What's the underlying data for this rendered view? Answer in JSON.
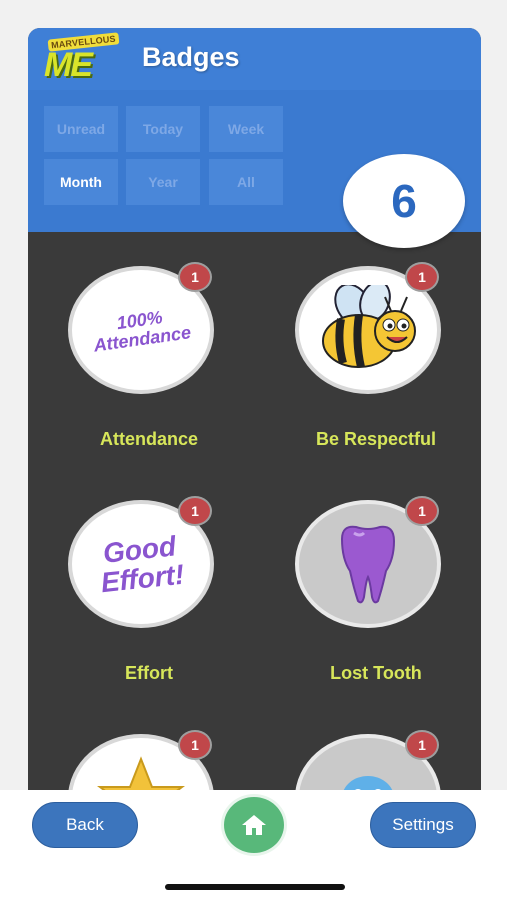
{
  "app": {
    "logo_small": "MARVELLOUS",
    "logo_main": "ME",
    "title": "Badges"
  },
  "filters": [
    {
      "label": "Unread",
      "active": false
    },
    {
      "label": "Today",
      "active": false
    },
    {
      "label": "Week",
      "active": false
    },
    {
      "label": "Month",
      "active": true
    },
    {
      "label": "Year",
      "active": false
    },
    {
      "label": "All",
      "active": false
    }
  ],
  "badge_count": "6",
  "badges": [
    {
      "label": "Attendance",
      "count": "1",
      "art": "100% Attendance",
      "icon": "attendance-badge-icon"
    },
    {
      "label": "Be Respectful",
      "count": "1",
      "art": "",
      "icon": "bee-badge-icon"
    },
    {
      "label": "Effort",
      "count": "1",
      "art": "Good Effort!",
      "icon": "effort-badge-icon"
    },
    {
      "label": "Lost Tooth",
      "count": "1",
      "art": "",
      "icon": "tooth-badge-icon"
    },
    {
      "label": "",
      "count": "1",
      "art": "",
      "icon": "star-badge-icon"
    },
    {
      "label": "",
      "count": "1",
      "art": "",
      "icon": "monster-badge-icon"
    }
  ],
  "bottom": {
    "back_label": "Back",
    "settings_label": "Settings",
    "home_icon": "home-icon"
  },
  "colors": {
    "header_blue": "#3f7fd6",
    "badge_label": "#d7e65a",
    "notif_red": "#c0474a",
    "home_green": "#58b87a"
  }
}
